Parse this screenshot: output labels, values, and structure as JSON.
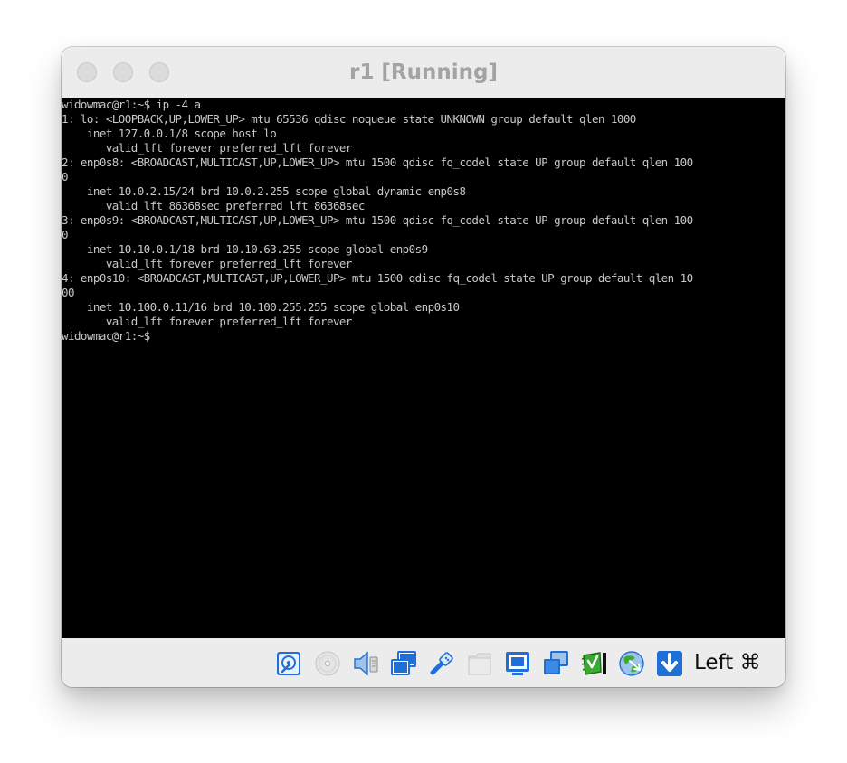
{
  "window": {
    "title": "r1 [Running]"
  },
  "terminal": {
    "lines": [
      "widowmac@r1:~$ ip -4 a",
      "1: lo: <LOOPBACK,UP,LOWER_UP> mtu 65536 qdisc noqueue state UNKNOWN group default qlen 1000",
      "    inet 127.0.0.1/8 scope host lo",
      "       valid_lft forever preferred_lft forever",
      "2: enp0s8: <BROADCAST,MULTICAST,UP,LOWER_UP> mtu 1500 qdisc fq_codel state UP group default qlen 100",
      "0",
      "    inet 10.0.2.15/24 brd 10.0.2.255 scope global dynamic enp0s8",
      "       valid_lft 86368sec preferred_lft 86368sec",
      "3: enp0s9: <BROADCAST,MULTICAST,UP,LOWER_UP> mtu 1500 qdisc fq_codel state UP group default qlen 100",
      "0",
      "    inet 10.10.0.1/18 brd 10.10.63.255 scope global enp0s9",
      "       valid_lft forever preferred_lft forever",
      "4: enp0s10: <BROADCAST,MULTICAST,UP,LOWER_UP> mtu 1500 qdisc fq_codel state UP group default qlen 10",
      "00",
      "    inet 10.100.0.11/16 brd 10.100.255.255 scope global enp0s10",
      "       valid_lft forever preferred_lft forever",
      "widowmac@r1:~$"
    ]
  },
  "statusbar": {
    "icons": [
      "hard-disk-icon",
      "optical-drive-icon",
      "audio-icon",
      "network-icon",
      "usb-icon",
      "shared-folders-icon",
      "display-icon",
      "video-capture-icon",
      "guest-additions-icon",
      "mouse-integration-icon",
      "keyboard-capture-icon"
    ],
    "host_key": "Left ⌘",
    "colors": {
      "accent_blue": "#1f6fd6",
      "accent_green": "#3aaa35"
    }
  }
}
